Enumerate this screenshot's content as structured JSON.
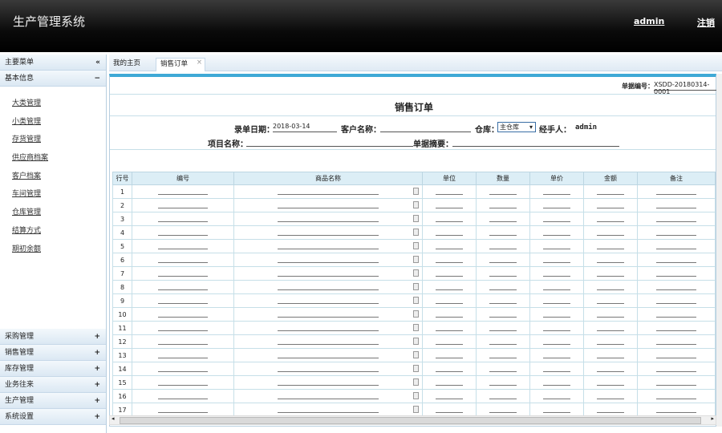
{
  "header": {
    "title": "生产管理系统",
    "user": "admin",
    "logout": "注销"
  },
  "sidebar": {
    "title": "主要菜单",
    "collapse": "«",
    "open_group": {
      "label": "基本信息",
      "toggle": "−"
    },
    "items": [
      "大类管理",
      "小类管理",
      "存货管理",
      "供应商档案",
      "客户档案",
      "车间管理",
      "仓库管理",
      "结算方式",
      "期初余额"
    ],
    "groups": [
      "采购管理",
      "销售管理",
      "库存管理",
      "业务往来",
      "生产管理",
      "系统设置"
    ],
    "group_toggle": "+"
  },
  "tabs": [
    {
      "label": "我的主页"
    },
    {
      "label": "销售订单",
      "close": "×"
    }
  ],
  "form": {
    "doc_no_label": "单据编号：",
    "doc_no": "XSDD-20180314-0001",
    "title": "销售订单",
    "date_label": "录单日期：",
    "date": "2018-03-14",
    "customer_label": "客户名称：",
    "customer": "",
    "warehouse_label": "仓库：",
    "warehouse": "主仓库",
    "handler_label": "经手人：",
    "handler": "admin",
    "project_label": "项目名称：",
    "project": "",
    "summary_label": "单据摘要：",
    "summary": ""
  },
  "table": {
    "columns": [
      "行号",
      "编号",
      "商品名称",
      "单位",
      "数量",
      "单价",
      "金额",
      "备注"
    ],
    "rows": [
      "1",
      "2",
      "3",
      "4",
      "5",
      "6",
      "7",
      "8",
      "9",
      "10",
      "11",
      "12",
      "13",
      "14",
      "15",
      "16",
      "17"
    ]
  }
}
